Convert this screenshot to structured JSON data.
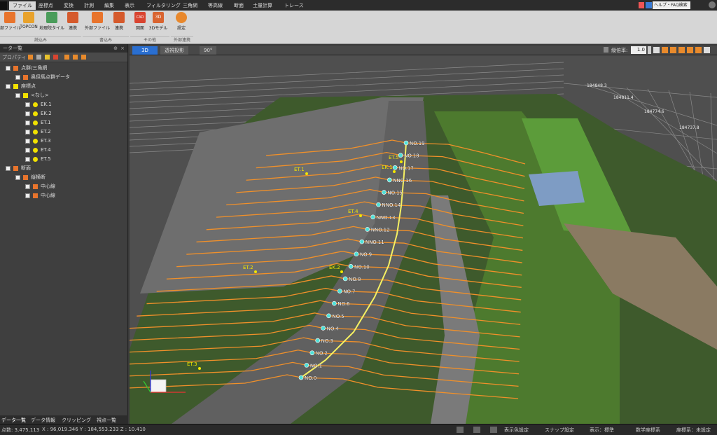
{
  "menu": {
    "items": [
      "ファイル",
      "座標点",
      "変換",
      "計測",
      "編集",
      "表示",
      "フィルタリング",
      "三角網",
      "等高線",
      "断面",
      "土量計算",
      "トレース"
    ],
    "help_label": "ヘルプ・FAQ検索"
  },
  "ribbon": {
    "buttons": [
      "部ファイル",
      "TOPCON",
      "地理院タイル",
      "連携",
      "外部ファイル",
      "連携",
      "図面",
      "3Dモデル",
      "設定"
    ],
    "icon_labels": {
      "cad": "CAD",
      "3d": "3D"
    },
    "groups": [
      "読込み",
      "書込み",
      "その他",
      "外部連携"
    ]
  },
  "panel": {
    "title": "ータ一覧",
    "toolbar_label": "プロパティ",
    "tree": [
      {
        "label": "点群/三角網",
        "level": 0,
        "icon": "cloud-icon"
      },
      {
        "label": "奥但馬点群データ",
        "level": 1,
        "icon": "pointcloud-icon"
      },
      {
        "label": "座標点",
        "level": 0,
        "icon": "points-icon"
      },
      {
        "label": "<なし>",
        "level": 1,
        "icon": "points-icon"
      },
      {
        "label": "EK.1",
        "level": 2,
        "icon": "point-icon"
      },
      {
        "label": "EK.2",
        "level": 2,
        "icon": "point-icon"
      },
      {
        "label": "ET.1",
        "level": 2,
        "icon": "point-icon"
      },
      {
        "label": "ET.2",
        "level": 2,
        "icon": "point-icon"
      },
      {
        "label": "ET.3",
        "level": 2,
        "icon": "point-icon"
      },
      {
        "label": "ET.4",
        "level": 2,
        "icon": "point-icon"
      },
      {
        "label": "ET.5",
        "level": 2,
        "icon": "point-icon"
      },
      {
        "label": "断面",
        "level": 0,
        "icon": "section-icon"
      },
      {
        "label": "縦横断",
        "level": 1,
        "icon": "section-icon"
      },
      {
        "label": "中心線",
        "level": 2,
        "icon": "line-icon"
      },
      {
        "label": "中心線",
        "level": 2,
        "icon": "line-icon"
      }
    ]
  },
  "panel_tabs": [
    "データ一覧",
    "データ情報",
    "クリッピング",
    "視点一覧"
  ],
  "view_tabs": [
    "3D",
    "透視投影",
    "90°"
  ],
  "view_toolbar": {
    "scale_label": "縦倍率:",
    "scale_value": "1.0"
  },
  "scene": {
    "grid_labels": [
      "184848.3",
      "184811.4",
      "184774.6",
      "184737.8"
    ],
    "station_labels": [
      "NO.19",
      "NO.18",
      "NO.17",
      "NNO.16",
      "NO.15",
      "NNO.14",
      "NNO.13",
      "NNO.12",
      "NNO.11",
      "NO.9",
      "NO.10",
      "NO.8",
      "NO.7",
      "NO.6",
      "NO.5",
      "NO.4",
      "NO.3",
      "NO.2",
      "NO.1",
      "NO.0"
    ],
    "point_labels": [
      "ET.1",
      "EK.1",
      "ET.5",
      "ET.4",
      "ET.2",
      "EK.2",
      "ET.3"
    ]
  },
  "status": {
    "points_label": "点数: 3,475,113",
    "coords": "X : 96,019.346 Y : 184,553.233 Z : 10.410",
    "buttons": [
      "表示色設定",
      "スナップ設定",
      "表示：標準",
      "数学座標系",
      "座標系：未設定"
    ]
  },
  "colors": {
    "accent": "#2a6fd1",
    "section_line": "#f0902a",
    "centerline": "#f5f062",
    "station": "#4fe0d8",
    "point_label": "#f3e600"
  }
}
